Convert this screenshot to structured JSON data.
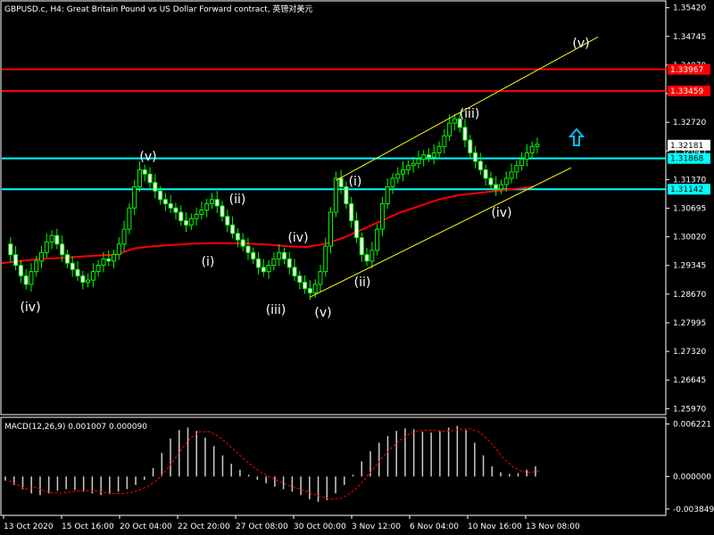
{
  "chart_data": {
    "type": "candlestick",
    "title": "GBPUSD.c, H4:  Great Britain Pound vs US Dollar Forward contract, 英镑对美元",
    "price_axis": {
      "ticks": [
        "1.35420",
        "1.34745",
        "1.34070",
        "1.33395",
        "1.32720",
        "1.32045",
        "1.31370",
        "1.30695",
        "1.30020",
        "1.29345",
        "1.28670",
        "1.27995",
        "1.27320",
        "1.26645",
        "1.25970"
      ],
      "ylim": [
        1.2583,
        1.3556
      ]
    },
    "time_axis": {
      "ticks": [
        "13 Oct 2020",
        "15 Oct 16:00",
        "20 Oct 04:00",
        "22 Oct 20:00",
        "27 Oct 08:00",
        "30 Oct 00:00",
        "3 Nov 12:00",
        "6 Nov 04:00",
        "10 Nov 16:00",
        "13 Nov 08:00"
      ]
    },
    "series": [
      {
        "name": "price",
        "values": [
          1.2985,
          1.296,
          1.2935,
          1.291,
          1.289,
          1.292,
          1.2945,
          1.2965,
          1.299,
          1.3005,
          1.2985,
          1.296,
          1.294,
          1.2925,
          1.291,
          1.2895,
          1.29,
          1.292,
          1.2935,
          1.295,
          1.2945,
          1.296,
          1.2985,
          1.302,
          1.307,
          1.312,
          1.316,
          1.315,
          1.313,
          1.311,
          1.309,
          1.308,
          1.307,
          1.306,
          1.304,
          1.303,
          1.3045,
          1.3055,
          1.3065,
          1.308,
          1.309,
          1.3075,
          1.305,
          1.303,
          1.301,
          1.2995,
          1.298,
          1.2965,
          1.295,
          1.293,
          1.292,
          1.2935,
          1.295,
          1.2965,
          1.295,
          1.293,
          1.291,
          1.2895,
          1.288,
          1.287,
          1.289,
          1.292,
          1.298,
          1.306,
          1.314,
          1.312,
          1.308,
          1.304,
          1.3,
          1.296,
          1.2945,
          1.297,
          1.302,
          1.308,
          1.312,
          1.314,
          1.315,
          1.316,
          1.317,
          1.3175,
          1.3185,
          1.3195,
          1.319,
          1.32,
          1.3215,
          1.324,
          1.327,
          1.328,
          1.326,
          1.323,
          1.32,
          1.318,
          1.316,
          1.314,
          1.3125,
          1.3115,
          1.3125,
          1.314,
          1.3155,
          1.317,
          1.3185,
          1.32,
          1.3215,
          1.322
        ]
      },
      {
        "name": "moving-average",
        "values": [
          1.294,
          1.2945,
          1.295,
          1.2952,
          1.2955,
          1.2958,
          1.296,
          1.2975,
          1.298,
          1.2983,
          1.2986,
          1.2987,
          1.2987,
          1.2986,
          1.2984,
          1.298,
          1.2978,
          1.2985,
          1.3,
          1.302,
          1.304,
          1.306,
          1.3075,
          1.309,
          1.31,
          1.3105,
          1.311,
          1.3115,
          1.312
        ]
      }
    ],
    "horizontal_levels": [
      {
        "label": "1.33967",
        "value": 1.33967,
        "color": "#ff0000"
      },
      {
        "label": "1.33459",
        "value": 1.33459,
        "color": "#ff0000"
      },
      {
        "label": "1.31868",
        "value": 1.31868,
        "color": "#00ffff"
      },
      {
        "label": "1.31142",
        "value": 1.31142,
        "color": "#00ffff"
      }
    ],
    "current_price": "1.32181",
    "wave_labels": [
      "(iv)",
      "(v)",
      "(ii)",
      "(i)",
      "(iv)",
      "(iii)",
      "(v)",
      "(i)",
      "(ii)",
      "(iii)",
      "(iv)",
      "(v)"
    ],
    "channel_color": "#ffff00",
    "arrow_color": "#00bfff",
    "macd": {
      "title": "MACD(12,26,9) 0.001007 0.000090",
      "ticks": [
        "0.006221",
        "0.000000",
        "-0.003849"
      ],
      "ylim": [
        -0.0045,
        0.0068
      ],
      "histogram": [
        -0.0005,
        -0.001,
        -0.0015,
        -0.002,
        -0.0022,
        -0.002,
        -0.0017,
        -0.0015,
        -0.0016,
        -0.0018,
        -0.002,
        -0.0022,
        -0.0021,
        -0.0018,
        -0.0015,
        -0.001,
        -0.0004,
        0.001,
        0.0028,
        0.0045,
        0.0055,
        0.0058,
        0.0054,
        0.0046,
        0.0036,
        0.0025,
        0.0015,
        0.0008,
        0.0002,
        -0.0004,
        -0.0008,
        -0.0012,
        -0.0015,
        -0.0018,
        -0.0022,
        -0.0027,
        -0.003,
        -0.0028,
        -0.002,
        -0.001,
        0.0002,
        0.0018,
        0.003,
        0.004,
        0.0048,
        0.0054,
        0.0057,
        0.0056,
        0.0053,
        0.0052,
        0.0054,
        0.0058,
        0.006,
        0.0055,
        0.004,
        0.0025,
        0.0012,
        0.0005,
        0.0003,
        0.0004,
        0.0008,
        0.0012
      ]
    }
  }
}
